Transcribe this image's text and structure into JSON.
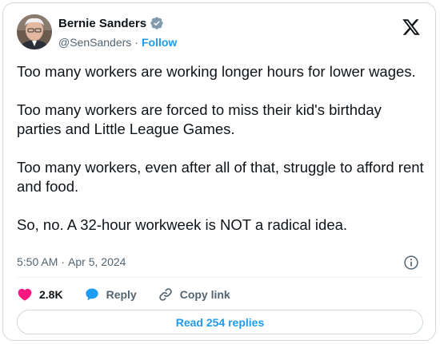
{
  "author": {
    "name": "Bernie Sanders",
    "handle": "@SenSanders",
    "separator": "·",
    "follow_label": "Follow"
  },
  "tweet": {
    "paragraphs": [
      "Too many workers are working longer hours for lower wages.",
      "Too many workers are forced to miss their kid's birthday parties and Little League Games.",
      "Too many workers, even after all of that, struggle to afford rent and food.",
      "So, no. A 32-hour workweek is NOT a radical idea."
    ],
    "time": "5:50 AM",
    "date": "Apr 5, 2024",
    "separator": "·"
  },
  "actions": {
    "likes": "2.8K",
    "reply_label": "Reply",
    "copy_link_label": "Copy link"
  },
  "replies": {
    "label": "Read 254 replies"
  },
  "colors": {
    "accent": "#1d9bf0",
    "like": "#f91880",
    "text": "#0f1419",
    "muted": "#536471",
    "border": "#cfd9de"
  },
  "icons": {
    "verified": "verified-badge-icon",
    "brand": "x-logo-icon",
    "info": "info-icon",
    "like": "heart-icon",
    "reply": "speech-bubble-icon",
    "copy": "link-icon"
  }
}
